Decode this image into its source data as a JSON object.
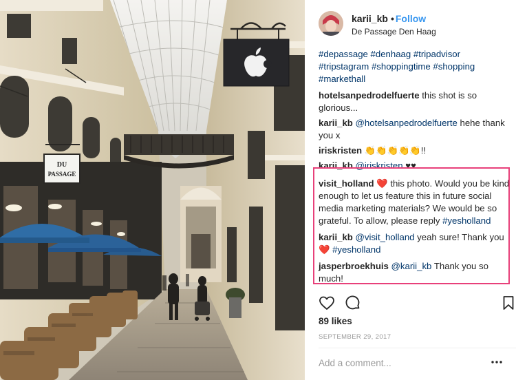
{
  "post": {
    "username": "karii_kb",
    "separator": "•",
    "follow_label": "Follow",
    "location": "De Passage Den Haag"
  },
  "photo": {
    "sign_text_top": "DU",
    "sign_text_bottom": "PASSAGE"
  },
  "caption": {
    "hashtags": "#depassage #denhaag #tripadvisor #tripstagram #shoppingtime #shopping #markethall"
  },
  "comments": [
    {
      "user": "hotelsanpedrodelfuerte",
      "text": " this shot is so glorious..."
    },
    {
      "user": "karii_kb",
      "mention": "@hotelsanpedrodelfuerte",
      "text": " hehe thank you x"
    },
    {
      "user": "iriskristen",
      "text": " 👏👏👏👏👏!!"
    },
    {
      "user": "karii_kb",
      "mention": "@iriskristen",
      "text": " ♥♥"
    },
    {
      "user": "visit_holland",
      "text": " ❤️ this photo. Would you be kind enough to let us feature this in future social media marketing materials? We would be so grateful. To allow, please reply ",
      "hashtag": "#yesholland"
    },
    {
      "user": "karii_kb",
      "mention": "@visit_holland",
      "text": " yeah sure! Thank you ❤️ ",
      "hashtag": "#yesholland"
    },
    {
      "user": "jasperbroekhuis",
      "mention": "@karii_kb",
      "text": " Thank you so much!"
    }
  ],
  "engagement": {
    "likes": "89 likes",
    "date": "SEPTEMBER 29, 2017"
  },
  "add_comment": {
    "placeholder": "Add a comment...",
    "value": ""
  },
  "colors": {
    "accent": "#3897f0",
    "link": "#003569",
    "highlight": "#e8407a"
  },
  "icons": [
    "heart-icon",
    "comment-icon",
    "bookmark-icon",
    "more-options-icon"
  ]
}
